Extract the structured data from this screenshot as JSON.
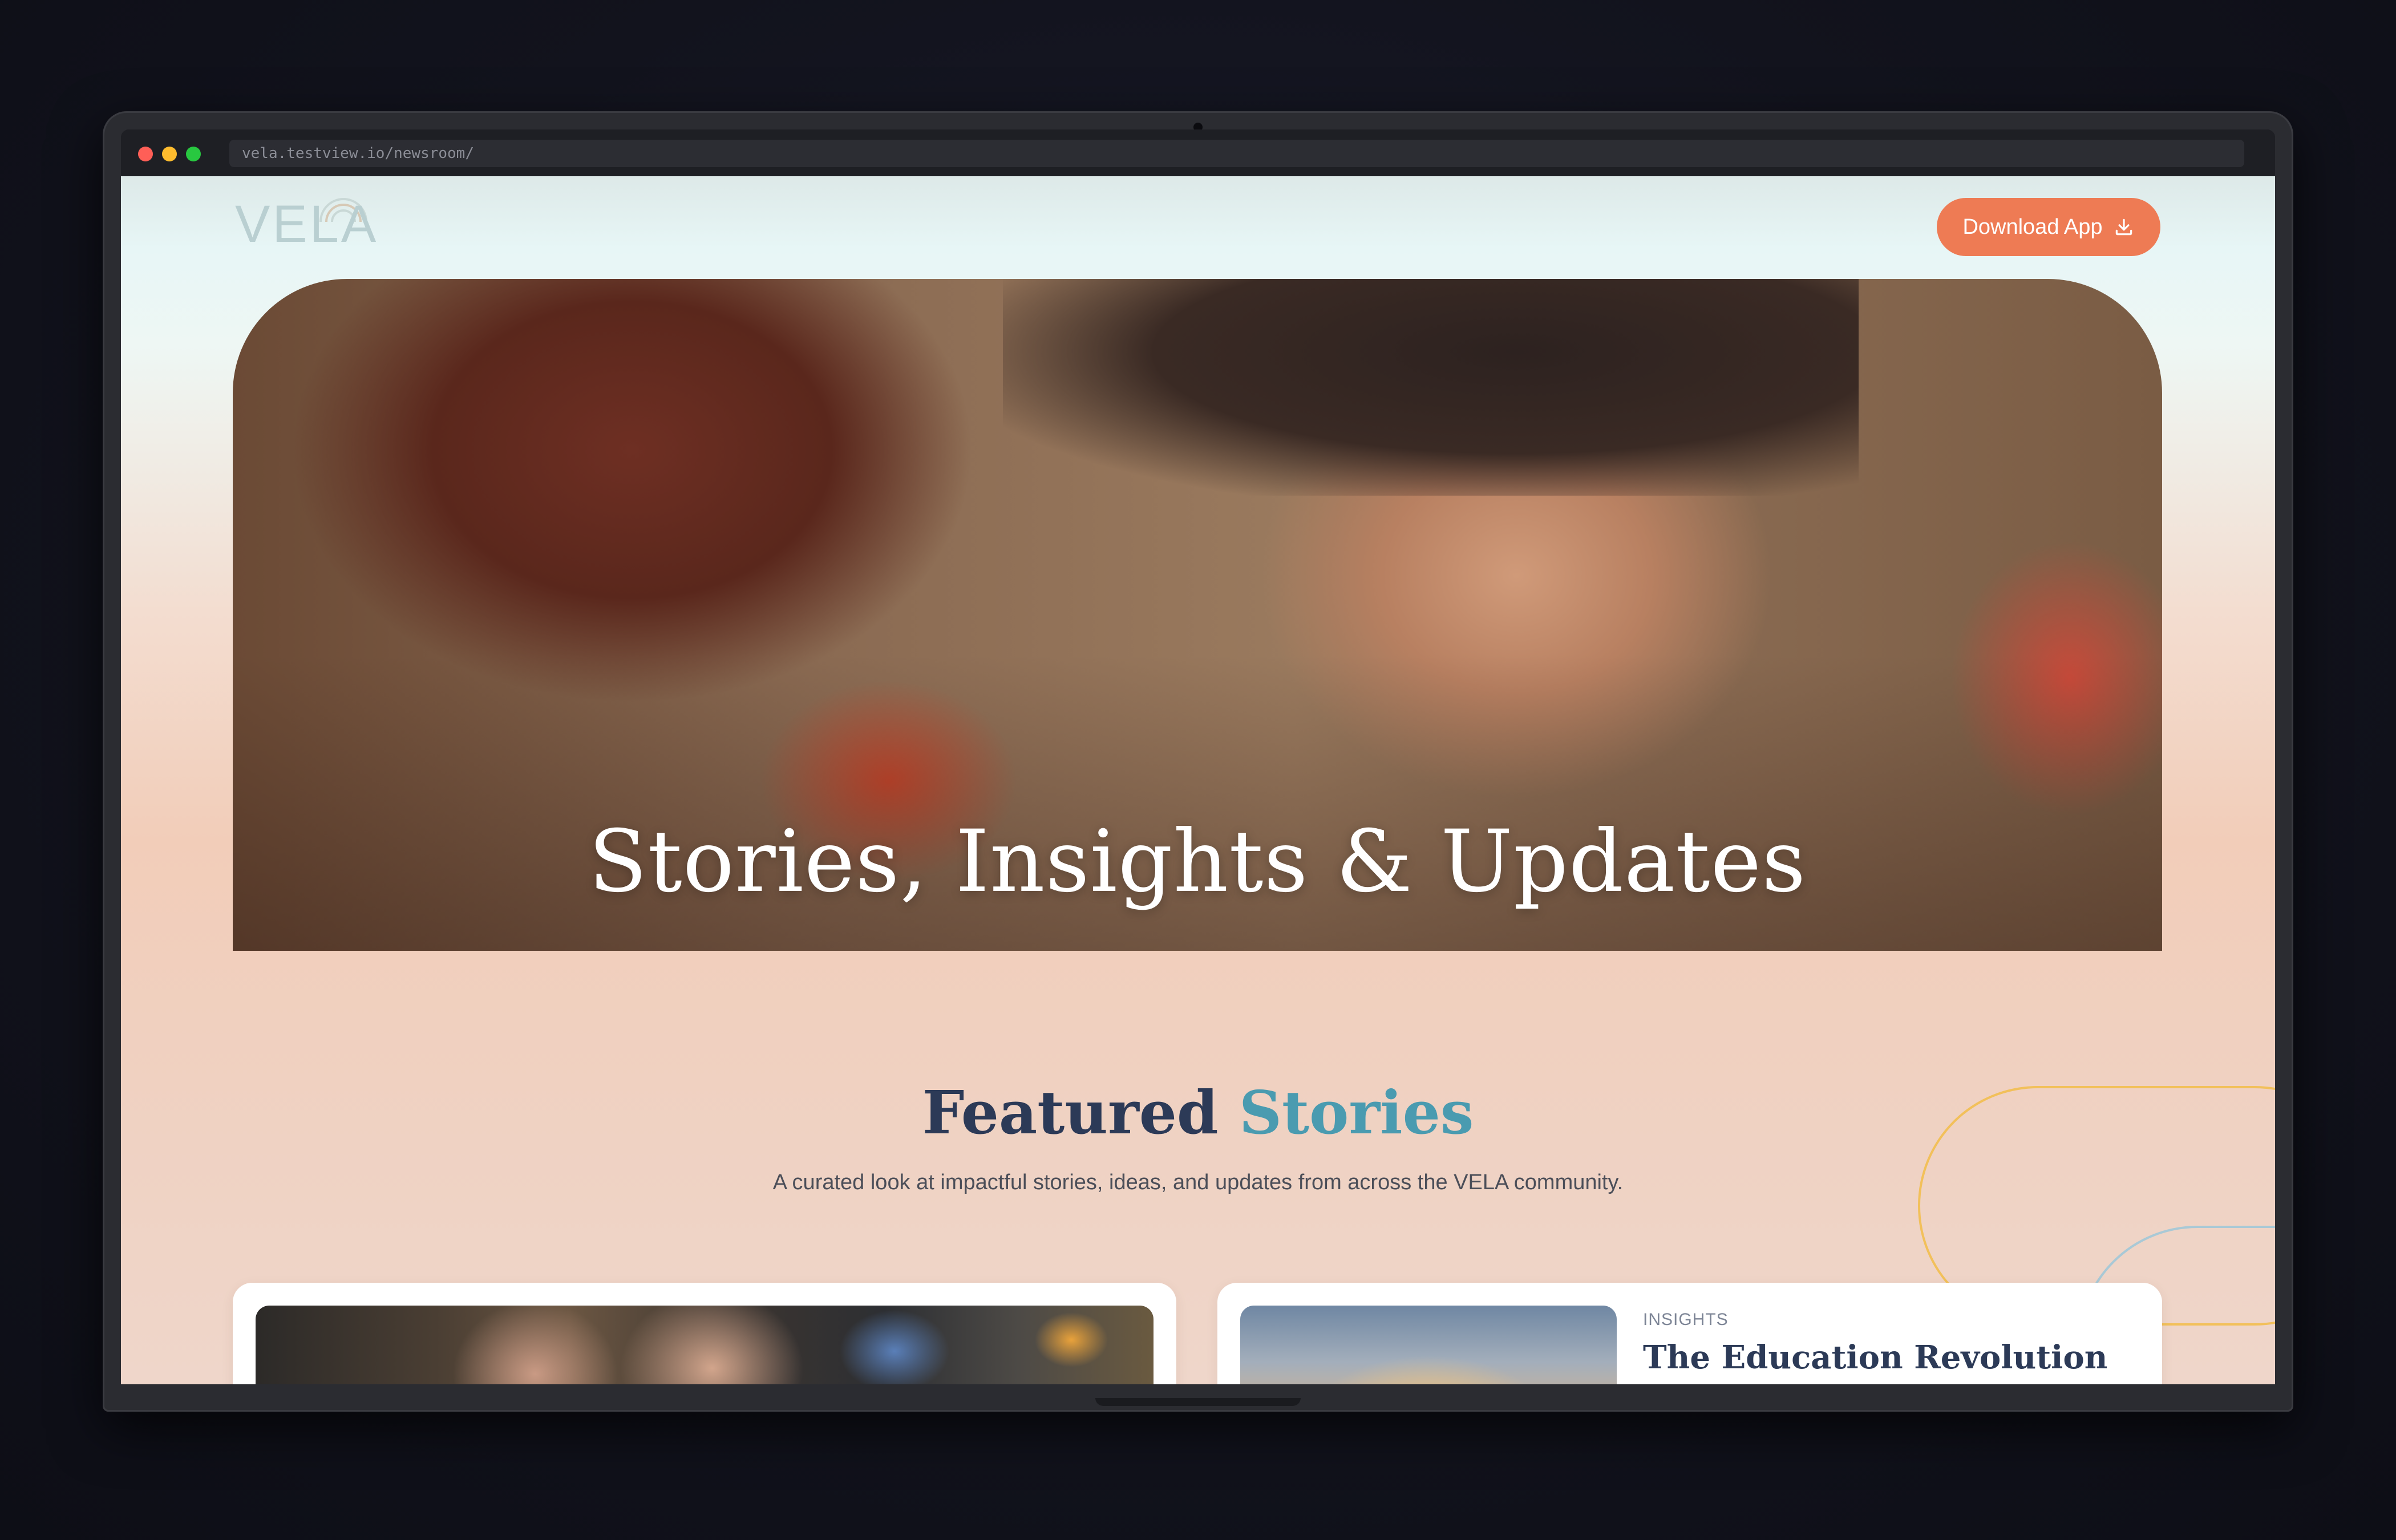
{
  "browser": {
    "url": "vela.testview.io/newsroom/"
  },
  "header": {
    "logo_text": "VELA",
    "download_label": "Download App"
  },
  "hero": {
    "title": "Stories, Insights & Updates"
  },
  "featured": {
    "title_main": "Featured",
    "title_accent": "Stories",
    "subtitle": "A curated look at impactful stories, ideas, and updates from across the VELA community."
  },
  "cards": [
    {
      "tag": "",
      "title": ""
    },
    {
      "tag": "INSIGHTS",
      "title": "The Education Revolution"
    }
  ],
  "colors": {
    "accent_orange": "#ee7b54",
    "title_navy": "#2c3a57",
    "title_teal": "#4a9bb0"
  },
  "icons": {
    "download": "download-icon"
  }
}
